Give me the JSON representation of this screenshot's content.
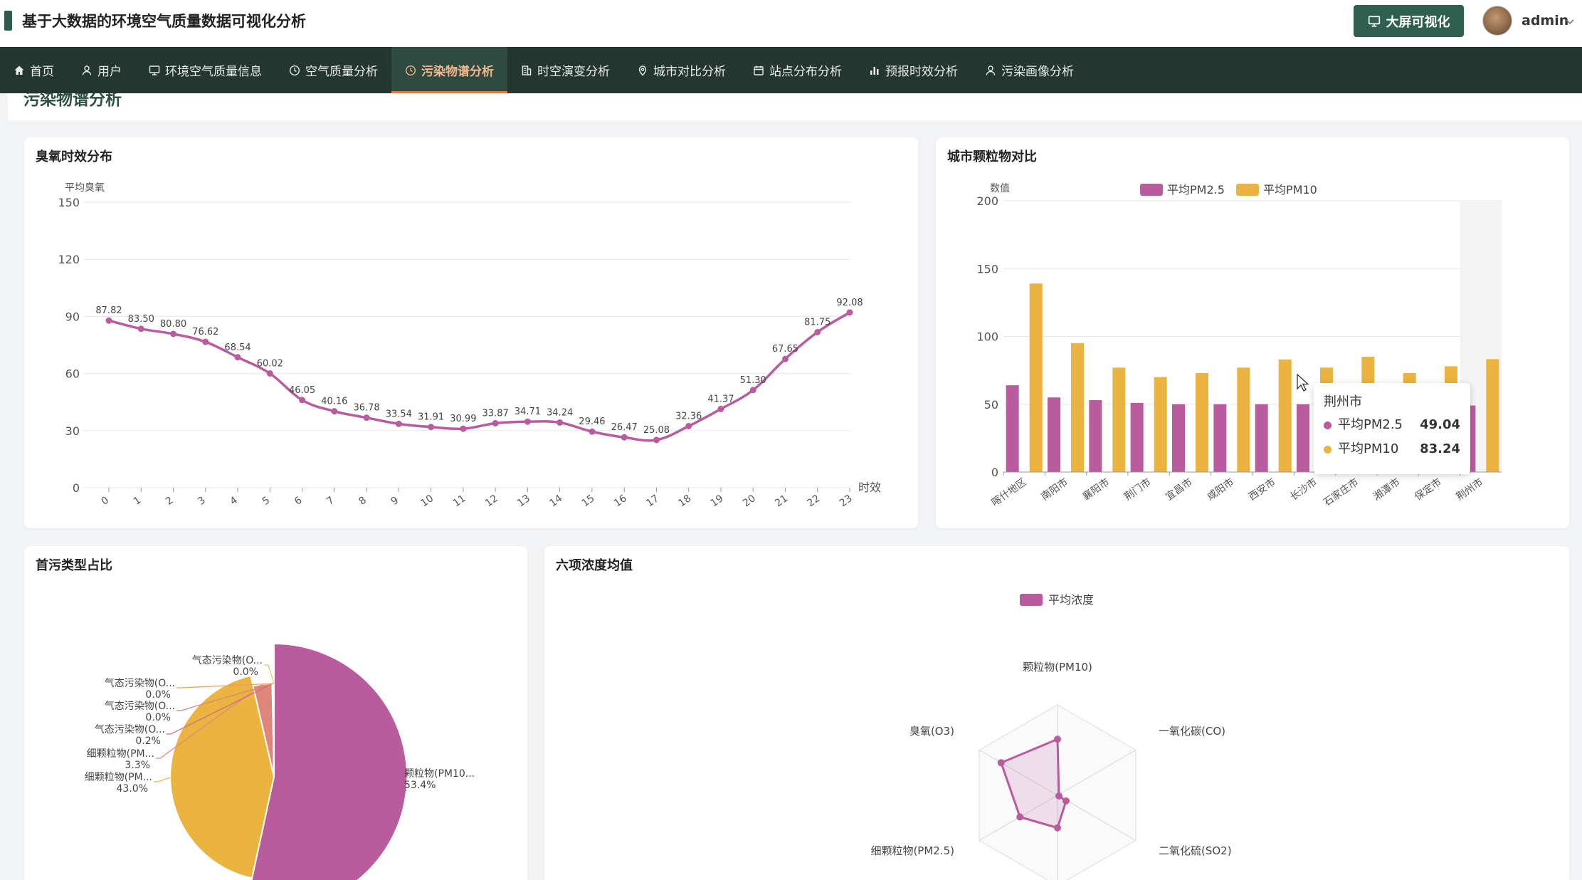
{
  "app": {
    "title": "基于大数据的环境空气质量数据可视化分析",
    "bigscreen_label": "大屏可视化",
    "username": "admin"
  },
  "nav": [
    {
      "label": "首页",
      "icon": "home-icon"
    },
    {
      "label": "用户",
      "icon": "user-icon"
    },
    {
      "label": "环境空气质量信息",
      "icon": "monitor-icon"
    },
    {
      "label": "空气质量分析",
      "icon": "clock-icon"
    },
    {
      "label": "污染物谱分析",
      "icon": "clock-icon",
      "active": true
    },
    {
      "label": "时空演变分析",
      "icon": "building-icon"
    },
    {
      "label": "城市对比分析",
      "icon": "location-pin-icon"
    },
    {
      "label": "站点分布分析",
      "icon": "calendar-icon"
    },
    {
      "label": "预报时效分析",
      "icon": "bar-chart-icon"
    },
    {
      "label": "污染画像分析",
      "icon": "user-icon"
    }
  ],
  "page": {
    "title": "污染物谱分析"
  },
  "colors": {
    "pm25": "#b85c9d",
    "pm10": "#ebb440",
    "nav_bg": "#243630",
    "accent_green": "#2f5f4f",
    "active_nav": "#f3b78f"
  },
  "chart_data": [
    {
      "type": "line",
      "title": "臭氧时效分布",
      "ylabel": "平均臭氧",
      "xlabel": "时效",
      "ylim": [
        0,
        150
      ],
      "yticks": [
        0,
        30,
        60,
        90,
        120,
        150
      ],
      "x": [
        "0",
        "1",
        "2",
        "3",
        "4",
        "5",
        "6",
        "7",
        "8",
        "9",
        "10",
        "11",
        "12",
        "13",
        "14",
        "15",
        "16",
        "17",
        "18",
        "19",
        "20",
        "21",
        "22",
        "23"
      ],
      "values": [
        87.82,
        83.5,
        80.8,
        76.62,
        68.54,
        60.02,
        46.05,
        40.16,
        36.78,
        33.54,
        31.91,
        30.99,
        33.87,
        34.71,
        34.24,
        29.46,
        26.47,
        25.08,
        32.36,
        41.37,
        51.3,
        67.65,
        81.75,
        92.08
      ],
      "labels": [
        "87.82",
        "83.50",
        "80.80",
        "76.62",
        "68.54",
        "60.02",
        "46.05",
        "40.16",
        "36.78",
        "33.54",
        "31.91",
        "30.99",
        "33.87",
        "34.71",
        "34.24",
        "29.46",
        "26.47",
        "25.08",
        "32.36",
        "41.37",
        "51.30",
        "67.65",
        "81.75",
        "92.08"
      ],
      "grid": true
    },
    {
      "type": "bar",
      "title": "城市颗粒物对比",
      "ylabel": "数值",
      "ylim": [
        0,
        200
      ],
      "yticks": [
        0,
        50,
        100,
        150,
        200
      ],
      "legend": "top-center",
      "categories": [
        "喀什地区",
        "南阳市",
        "襄阳市",
        "荆门市",
        "宜昌市",
        "咸阳市",
        "西安市",
        "长沙市",
        "石家庄市",
        "湘潭市",
        "保定市",
        "荆州市"
      ],
      "series": [
        {
          "name": "平均PM2.5",
          "values": [
            64,
            55,
            53,
            51,
            50,
            50,
            50,
            50,
            50,
            49,
            49,
            49.04
          ]
        },
        {
          "name": "平均PM10",
          "values": [
            139,
            95,
            77,
            70,
            73,
            77,
            83,
            77,
            85,
            73,
            78,
            83.24
          ]
        }
      ],
      "tooltip": {
        "title": "荆州市",
        "rows": [
          {
            "name": "平均PM2.5",
            "value": "49.04"
          },
          {
            "name": "平均PM10",
            "value": "83.24"
          }
        ]
      }
    },
    {
      "type": "pie",
      "title": "首污类型占比",
      "slices": [
        {
          "label": "颗粒物(PM10...",
          "pct": "53.4%",
          "value": 53.4,
          "color": "#b85c9d"
        },
        {
          "label": "细颗粒物(PM...",
          "pct": "43.0%",
          "value": 43.0,
          "color": "#ebb440"
        },
        {
          "label": "细颗粒物(PM...",
          "pct": "3.3%",
          "value": 3.3,
          "color": "#e0857a"
        },
        {
          "label": "气态污染物(O...",
          "pct": "0.2%",
          "value": 0.2,
          "color": "#c96b88"
        },
        {
          "label": "气态污染物(O...",
          "pct": "0.0%",
          "value": 0.04,
          "color": "#d9847a"
        },
        {
          "label": "气态污染物(O...",
          "pct": "0.0%",
          "value": 0.03,
          "color": "#e6a05a"
        },
        {
          "label": "气态污染物(O...",
          "pct": "0.0%",
          "value": 0.03,
          "color": "#ebc45a"
        }
      ]
    },
    {
      "type": "radar",
      "title": "六项浓度均值",
      "legend": "top-center",
      "series_name": "平均浓度",
      "indicators": [
        "颗粒物(PM10)",
        "一氧化碳(CO)",
        "二氧化硫(SO2)",
        "细颗粒物(PM2.5)",
        "臭氧(O3)"
      ],
      "values": [
        0.62,
        0.04,
        0.36,
        0.48,
        0.72
      ]
    }
  ]
}
